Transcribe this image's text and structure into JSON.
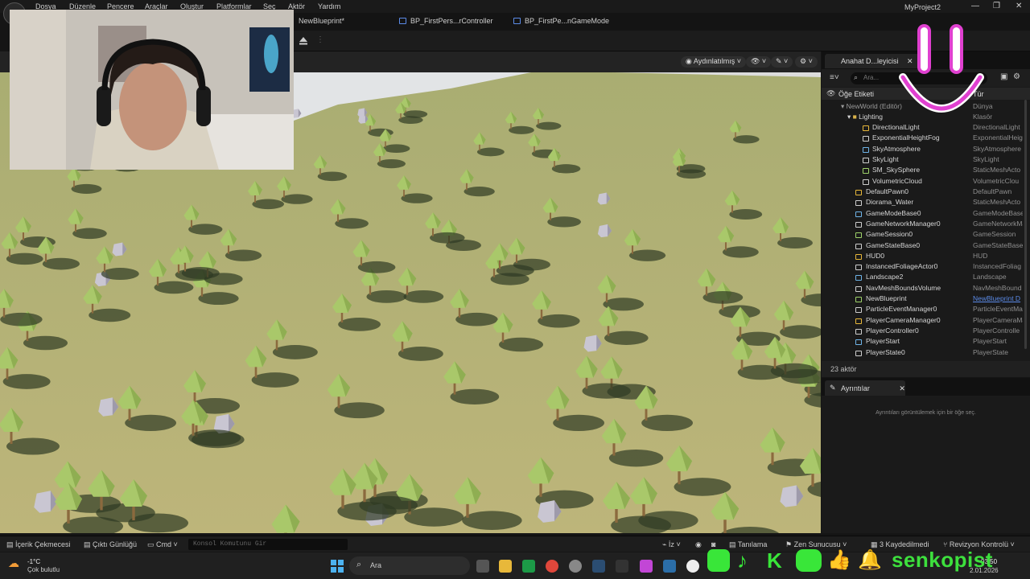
{
  "menu": [
    "Dosya",
    "Düzenle",
    "Pencere",
    "Araçlar",
    "Oluştur",
    "Platformlar",
    "Seç",
    "Aktör",
    "Yardım"
  ],
  "project_name": "MyProject2",
  "tabs": [
    "NewBlueprint*",
    "BP_FirstPers...rController",
    "BP_FirstPe...nGameMode"
  ],
  "viewport": {
    "lighting_mode": "Aydınlatılmış"
  },
  "outliner": {
    "tab_label": "Anahat D...leyicisi",
    "search_placeholder": "Ara...",
    "column_label": "Öğe Etiketi",
    "column_type": "Tür",
    "world": "NewWorld (Editör)",
    "world_type": "Dünya",
    "folder": "Lighting",
    "folder_type": "Klasör",
    "items": [
      {
        "name": "DirectionalLight",
        "type": "DirectionalLight",
        "indent": 2
      },
      {
        "name": "ExponentialHeightFog",
        "type": "ExponentialHeig",
        "indent": 2
      },
      {
        "name": "SkyAtmosphere",
        "type": "SkyAtmosphere",
        "indent": 2
      },
      {
        "name": "SkyLight",
        "type": "SkyLight",
        "indent": 2
      },
      {
        "name": "SM_SkySphere",
        "type": "StaticMeshActo",
        "indent": 2
      },
      {
        "name": "VolumetricCloud",
        "type": "VolumetricClou",
        "indent": 2
      },
      {
        "name": "DefaultPawn0",
        "type": "DefaultPawn",
        "indent": 1
      },
      {
        "name": "Diorama_Water",
        "type": "StaticMeshActo",
        "indent": 1
      },
      {
        "name": "GameModeBase0",
        "type": "GameModeBase",
        "indent": 1
      },
      {
        "name": "GameNetworkManager0",
        "type": "GameNetworkMa",
        "indent": 1
      },
      {
        "name": "GameSession0",
        "type": "GameSession",
        "indent": 1
      },
      {
        "name": "GameStateBase0",
        "type": "GameStateBase",
        "indent": 1
      },
      {
        "name": "HUD0",
        "type": "HUD",
        "indent": 1
      },
      {
        "name": "InstancedFoliageActor0",
        "type": "InstancedFoliag",
        "indent": 1
      },
      {
        "name": "Landscape2",
        "type": "Landscape",
        "indent": 1
      },
      {
        "name": "NavMeshBoundsVolume",
        "type": "NavMeshBound",
        "indent": 1
      },
      {
        "name": "NewBlueprint",
        "type": "NewBlueprint D",
        "indent": 1
      },
      {
        "name": "ParticleEventManager0",
        "type": "ParticleEventMa",
        "indent": 1
      },
      {
        "name": "PlayerCameraManager0",
        "type": "PlayerCameraMa",
        "indent": 1
      },
      {
        "name": "PlayerController0",
        "type": "PlayerControlle",
        "indent": 1
      },
      {
        "name": "PlayerStart",
        "type": "PlayerStart",
        "indent": 1
      },
      {
        "name": "PlayerState0",
        "type": "PlayerState",
        "indent": 1
      }
    ],
    "actor_count": "23 aktör"
  },
  "details": {
    "tab_label": "Ayrıntılar",
    "empty_message": "Ayrıntıları görüntülemek için bir öğe seç."
  },
  "statusbar": {
    "content_drawer": "İçerik Çekmecesi",
    "output_log": "Çıktı Günlüğü",
    "cmd": "Cmd",
    "console_placeholder": "Konsol Komutunu Gir",
    "trace": "İz",
    "diagnostics": "Tanılama",
    "zen": "Zen Sunucusu",
    "saved": "3 Kaydedilmedi",
    "revision": "Revizyon Kontrolü"
  },
  "taskbar": {
    "weather_temp": "-1°C",
    "weather_desc": "Çok bulutlu",
    "search_label": "Ara",
    "time": "03:50",
    "date": "2.01.2026"
  },
  "overlay": {
    "brand": "senkopist"
  },
  "colors": {
    "accent": "#5b8be8",
    "brand_green": "#3de03d",
    "smile_pink": "#e040d0"
  }
}
